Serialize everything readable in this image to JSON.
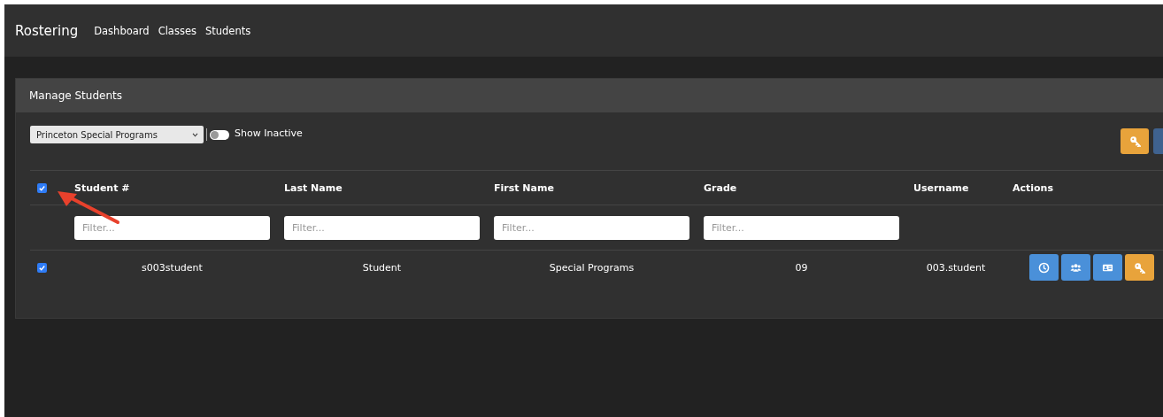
{
  "navbar": {
    "brand": "Rostering",
    "links": [
      {
        "label": "Dashboard"
      },
      {
        "label": "Classes"
      },
      {
        "label": "Students"
      }
    ]
  },
  "card": {
    "title": "Manage Students",
    "school_select": {
      "value": "Princeton Special Programs"
    },
    "show_inactive": {
      "label": "Show Inactive",
      "on": false
    },
    "toolbar_buttons": [
      {
        "kind": "key"
      },
      {
        "kind": "blank"
      }
    ],
    "table": {
      "select_all": {
        "checked": true
      },
      "columns": [
        {
          "label": "Student #"
        },
        {
          "label": "Last Name"
        },
        {
          "label": "First Name"
        },
        {
          "label": "Grade"
        },
        {
          "label": "Username"
        },
        {
          "label": "Actions"
        }
      ],
      "filters": [
        {
          "placeholder": "Filter..."
        },
        {
          "placeholder": "Filter..."
        },
        {
          "placeholder": "Filter..."
        },
        {
          "placeholder": "Filter..."
        }
      ],
      "rows": [
        {
          "checked": true,
          "cells": [
            "s003student",
            "Student",
            "Special Programs",
            "09",
            "003.student"
          ],
          "actions": [
            {
              "kind": "clock"
            },
            {
              "kind": "users"
            },
            {
              "kind": "idcard"
            },
            {
              "kind": "key"
            }
          ]
        }
      ]
    }
  },
  "annotation": {
    "kind": "arrow"
  }
}
